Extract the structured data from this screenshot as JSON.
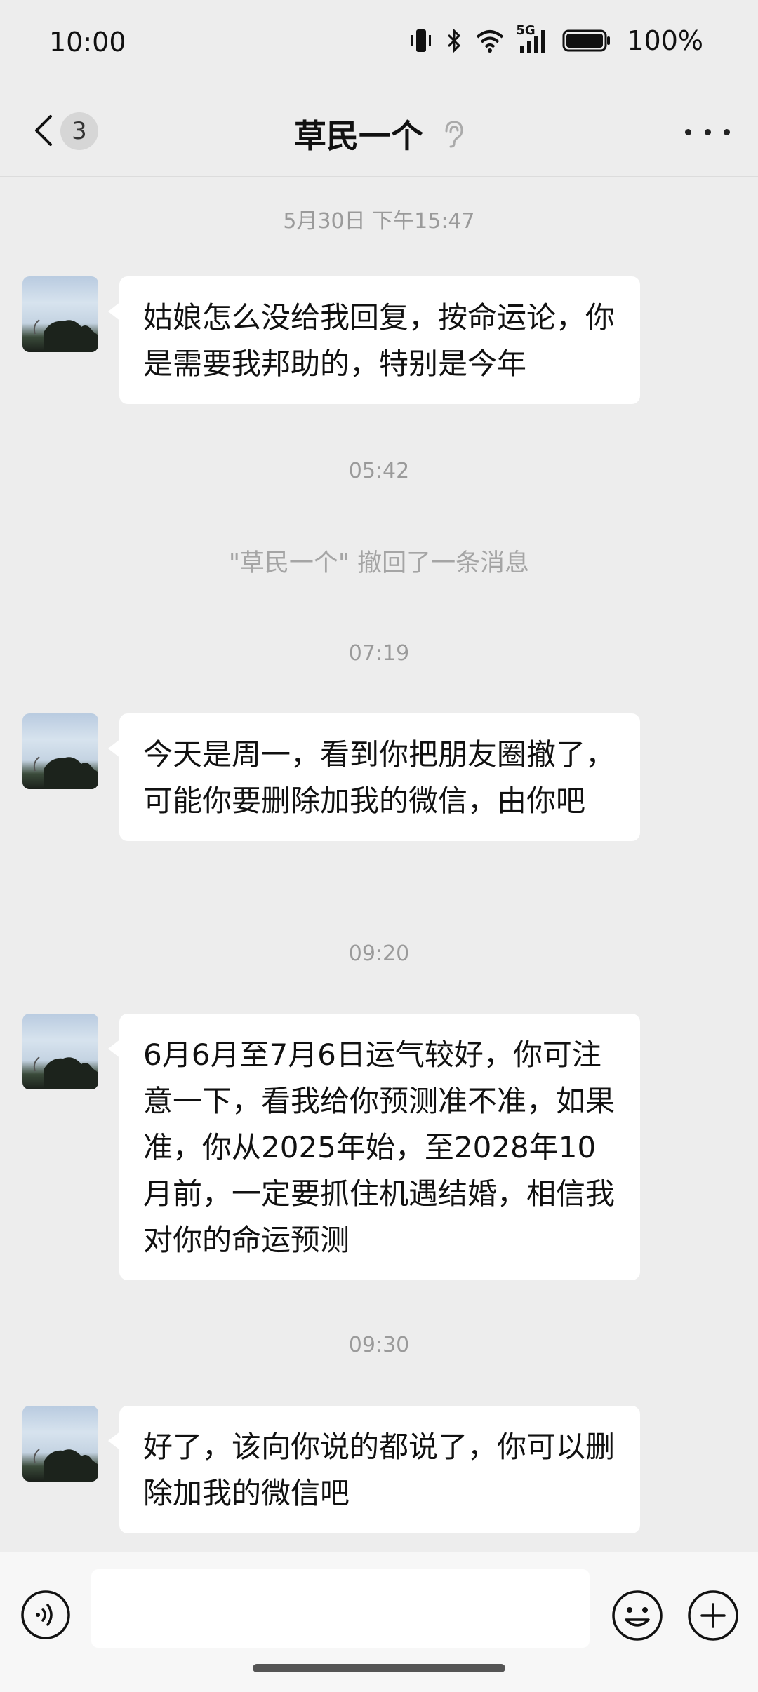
{
  "status_bar": {
    "time": "10:00",
    "network": "5G",
    "battery": "100%",
    "icons": [
      "vibrate-icon",
      "bluetooth-icon",
      "wifi-icon",
      "signal-icon",
      "battery-icon"
    ]
  },
  "nav": {
    "title": "草民一个",
    "unread_count": "3",
    "icons": [
      "back-chevron-icon",
      "ear-icon",
      "more-icon"
    ]
  },
  "messages": [
    {
      "kind": "time",
      "text": "5月30日 下午15:47"
    },
    {
      "kind": "incoming",
      "text": "姑娘怎么没给我回复，按命运论，你是需要我邦助的，特别是今年"
    },
    {
      "kind": "time",
      "text": "05:42"
    },
    {
      "kind": "system",
      "text": "\"草民一个\" 撤回了一条消息"
    },
    {
      "kind": "time",
      "text": "07:19"
    },
    {
      "kind": "incoming",
      "text": "今天是周一，看到你把朋友圈撤了，可能你要删除加我的微信，由你吧"
    },
    {
      "kind": "time",
      "text": "09:20"
    },
    {
      "kind": "incoming",
      "text": "6月6月至7月6日运气较好，你可注意一下，看我给你预测准不准，如果准，你从2025年始，至2028年10月前，一定要抓住机遇结婚，相信我对你的命运预测"
    },
    {
      "kind": "time",
      "text": "09:30"
    },
    {
      "kind": "incoming",
      "text": "好了，该向你说的都说了，你可以删除加我的微信吧"
    }
  ],
  "input_bar": {
    "value": "",
    "icons": [
      "voice-icon",
      "emoji-icon",
      "plus-icon"
    ]
  }
}
